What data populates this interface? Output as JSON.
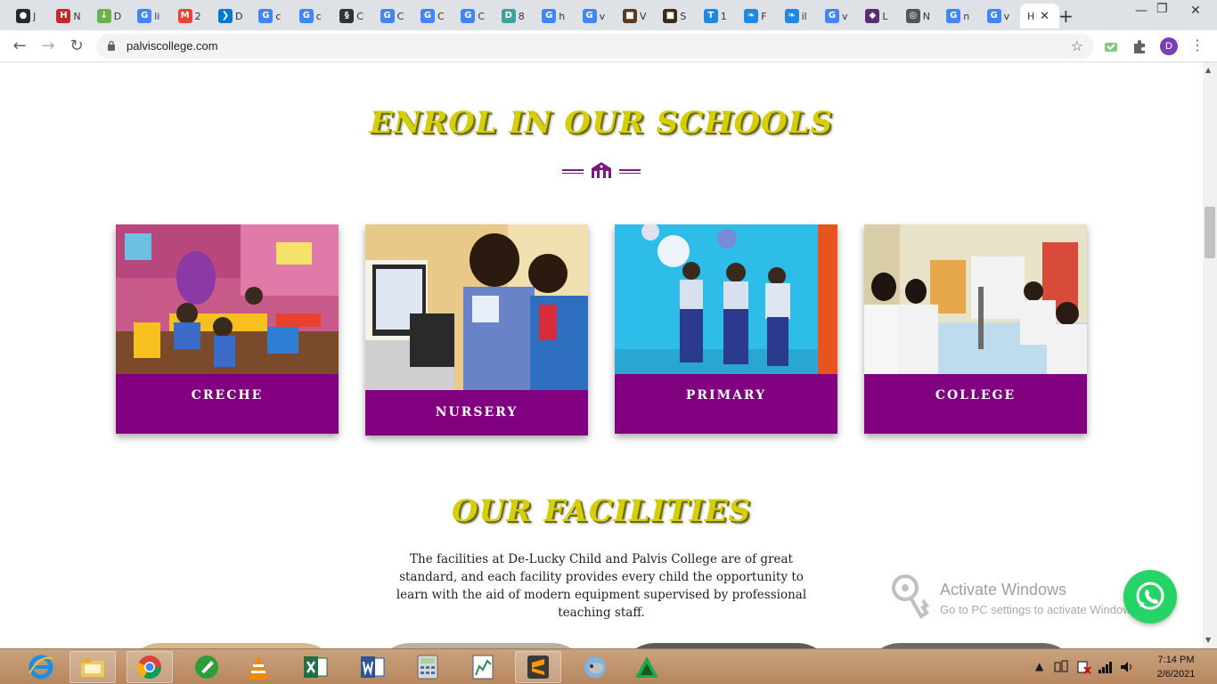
{
  "browser": {
    "tabs": [
      {
        "fav": "github-icon",
        "color": "#24292e",
        "title": "J"
      },
      {
        "fav": "hsu-icon",
        "color": "#c62828",
        "title": "N"
      },
      {
        "fav": "download-icon",
        "color": "#6ab04c",
        "title": "D"
      },
      {
        "fav": "google-icon",
        "color": "#4285f4",
        "title": "li"
      },
      {
        "fav": "gmail-icon",
        "color": "#ea4335",
        "title": "2"
      },
      {
        "fav": "vscode-icon",
        "color": "#0078d4",
        "title": "D"
      },
      {
        "fav": "google-icon",
        "color": "#4285f4",
        "title": "c"
      },
      {
        "fav": "google-icon",
        "color": "#4285f4",
        "title": "c"
      },
      {
        "fav": "dna-icon",
        "color": "#333333",
        "title": "C"
      },
      {
        "fav": "google-icon",
        "color": "#4285f4",
        "title": "C"
      },
      {
        "fav": "google-icon",
        "color": "#4285f4",
        "title": "C"
      },
      {
        "fav": "google-icon",
        "color": "#4285f4",
        "title": "C"
      },
      {
        "fav": "d-icon",
        "color": "#3aa39c",
        "title": "8"
      },
      {
        "fav": "google-icon",
        "color": "#4285f4",
        "title": "h"
      },
      {
        "fav": "google-icon",
        "color": "#4285f4",
        "title": "v"
      },
      {
        "fav": "image-icon",
        "color": "#5a3a1e",
        "title": "V"
      },
      {
        "fav": "image-icon",
        "color": "#3a2a1a",
        "title": "S"
      },
      {
        "fav": "t-icon",
        "color": "#1e88e5",
        "title": "1"
      },
      {
        "fav": "bird-icon",
        "color": "#1e88e5",
        "title": "F"
      },
      {
        "fav": "bird-icon",
        "color": "#1e88e5",
        "title": "il"
      },
      {
        "fav": "google-icon",
        "color": "#4285f4",
        "title": "v"
      },
      {
        "fav": "shield-icon",
        "color": "#5b2c6f",
        "title": "L"
      },
      {
        "fav": "globe-icon",
        "color": "#555555",
        "title": "N"
      },
      {
        "fav": "google-icon",
        "color": "#4285f4",
        "title": "n"
      },
      {
        "fav": "google-icon",
        "color": "#4285f4",
        "title": "v"
      }
    ],
    "active_tab_title": "H",
    "url": "palviscollege.com",
    "profile_initial": "D"
  },
  "page": {
    "enrol_title": "ENROL IN OUR SCHOOLS",
    "cards": [
      {
        "label": "CRECHE"
      },
      {
        "label": "NURSERY"
      },
      {
        "label": "PRIMARY"
      },
      {
        "label": "COLLEGE"
      }
    ],
    "facilities_title": "OUR FACILITIES",
    "facilities_text": "The facilities at De-Lucky Child and Palvis College are of great standard, and each facility provides every child the opportunity to learn with the aid of modern equipment supervised by professional teaching staff.",
    "accent_color": "#800080",
    "title_color": "#d4cf0a"
  },
  "watermark": {
    "line1": "Activate Windows",
    "line2": "Go to PC settings to activate Windows."
  },
  "taskbar": {
    "apps": [
      "internet-explorer-icon",
      "file-explorer-icon",
      "chrome-icon",
      "app-icon",
      "vlc-icon",
      "excel-icon",
      "word-icon",
      "calculator-icon",
      "graph-icon",
      "sublime-icon",
      "app-icon",
      "app-icon"
    ],
    "time": "7:14 PM",
    "date": "2/6/2021"
  }
}
